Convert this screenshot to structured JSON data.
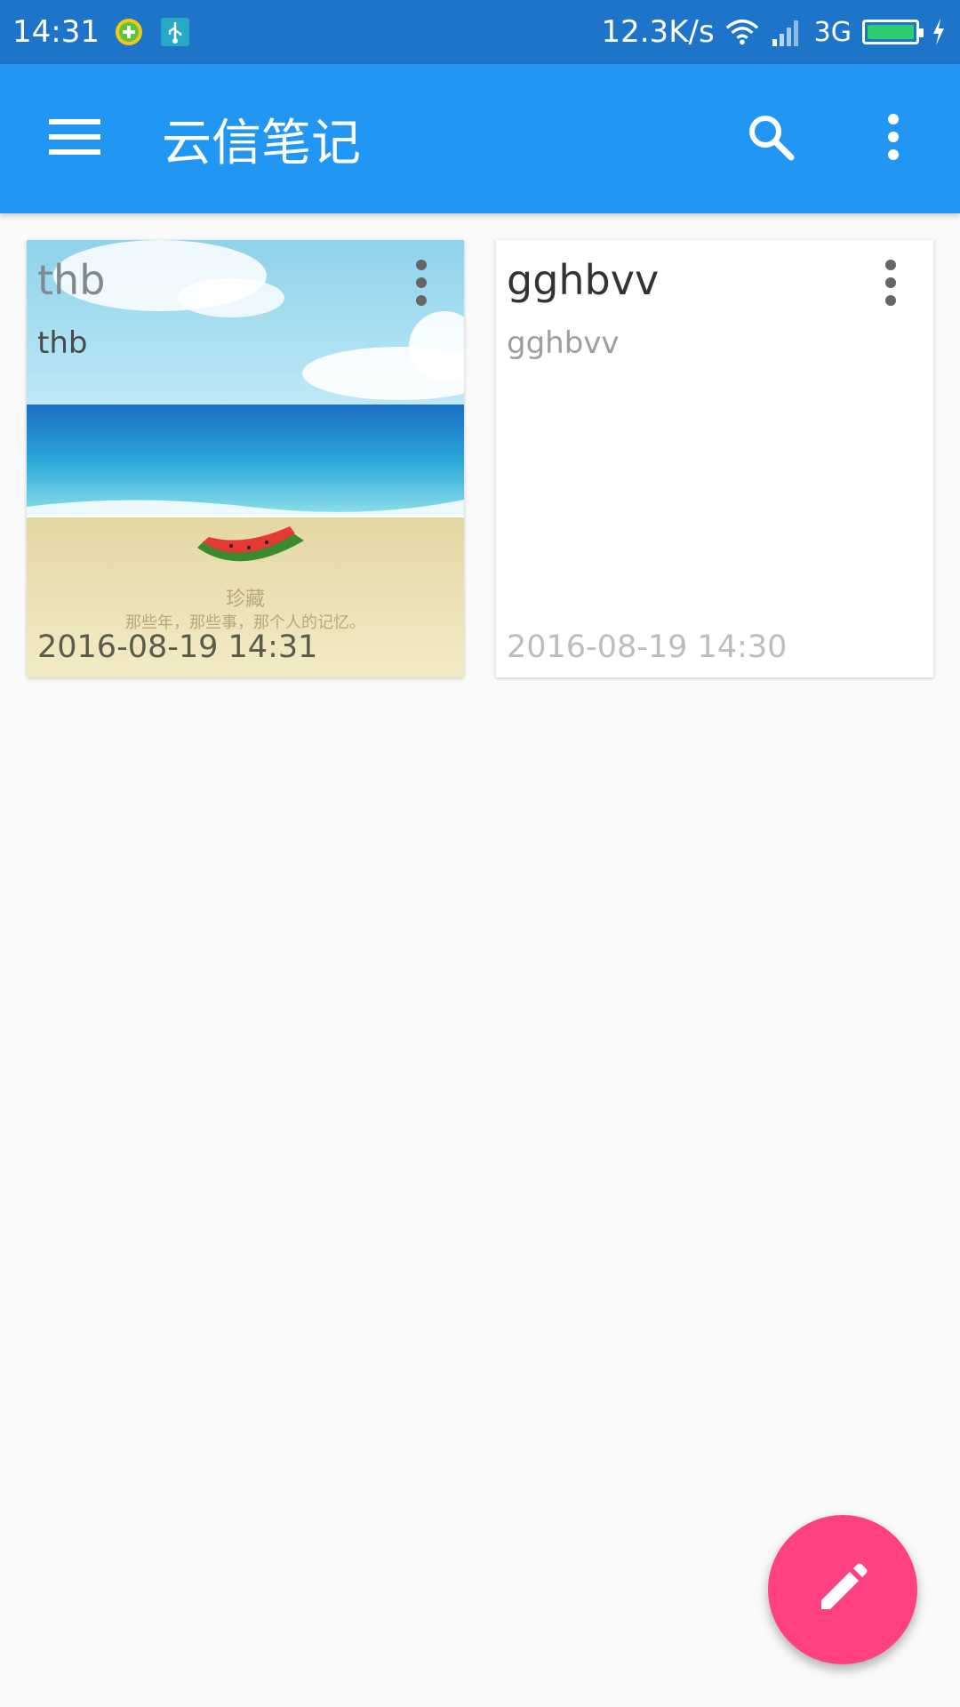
{
  "status_bar": {
    "time": "14:31",
    "net_speed": "12.3K/s",
    "network_type": "3G",
    "icons": [
      "app-notification-icon",
      "usb-icon",
      "wifi-icon",
      "signal-icon",
      "battery-icon",
      "charging-icon"
    ],
    "battery_color": "#2ecc71"
  },
  "app_bar": {
    "title": "云信笔记",
    "color": "#2196f3",
    "icons": [
      "menu-icon",
      "search-icon",
      "more-vert-icon"
    ]
  },
  "notes": [
    {
      "title": "thb",
      "body": "thb",
      "date": "2016-08-19 14:31",
      "background": "beach-watermelon-image",
      "image_caption_title": "珍藏",
      "image_caption_text": "那些年，那些事，那个人的记忆。"
    },
    {
      "title": "gghbvv",
      "body": "gghbvv",
      "date": "2016-08-19 14:30",
      "background": "white"
    }
  ],
  "fab": {
    "icon": "edit-pencil-icon",
    "color": "#ff4081"
  }
}
